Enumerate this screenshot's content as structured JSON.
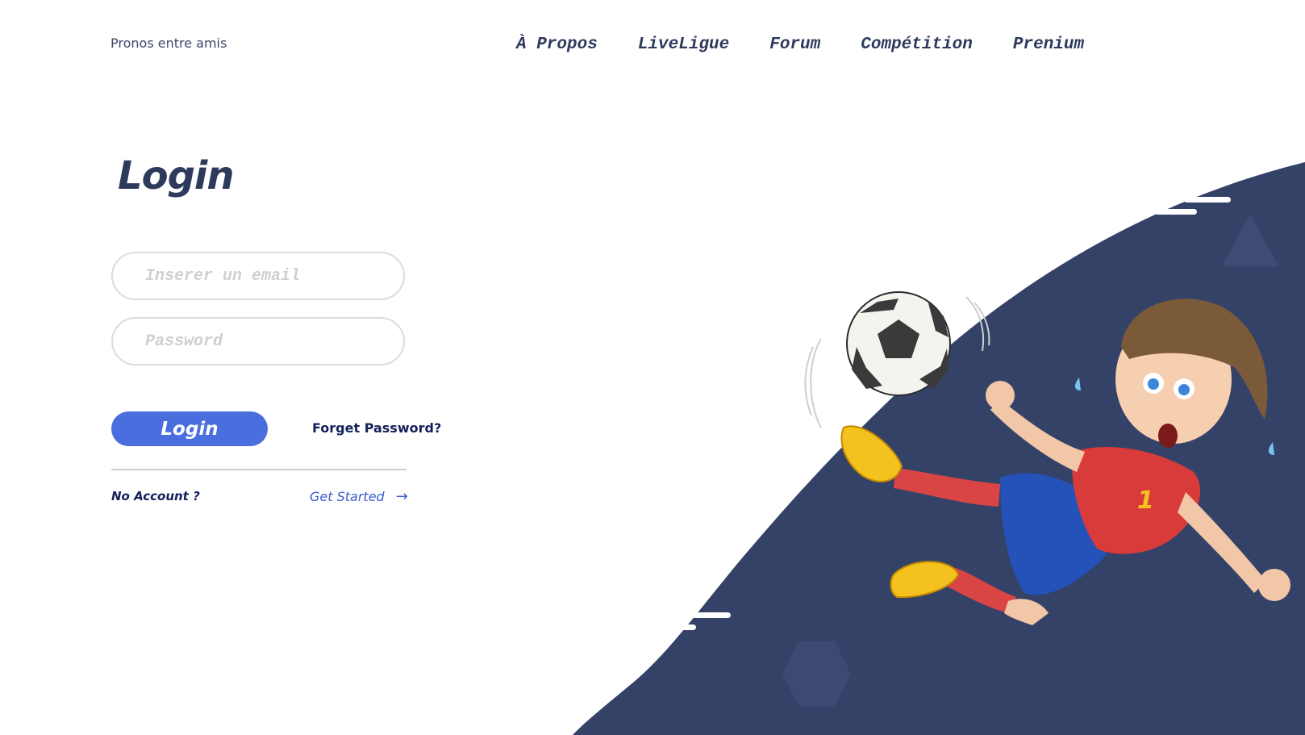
{
  "header": {
    "brand": "Pronos entre amis",
    "nav": [
      "À Propos",
      "LiveLigue",
      "Forum",
      "Compétition",
      "Prenium"
    ]
  },
  "login": {
    "title": "Login",
    "email_placeholder": "Inserer un email",
    "password_placeholder": "Password",
    "submit_label": "Login",
    "forget_label": "Forget Password?",
    "no_account_label": "No Account ?",
    "get_started_label": "Get Started",
    "get_started_icon": "arrow-right-icon"
  },
  "illustration": {
    "player_number": "1",
    "colors": {
      "panel": "#354268",
      "accent_button": "#4a6ede",
      "jersey": "#d93a3a",
      "shorts": "#2452b8",
      "boots": "#f3c21f"
    }
  }
}
